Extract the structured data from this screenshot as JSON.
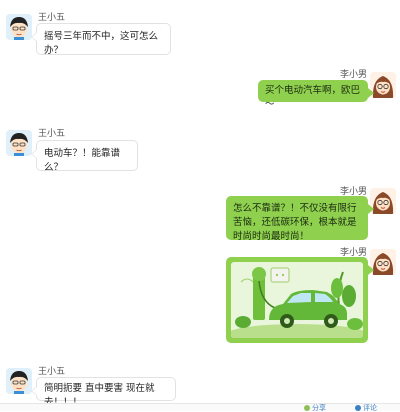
{
  "messages": [
    {
      "sender": "王小五",
      "side": "left",
      "text": "摇号三年而不中，这可怎么办？"
    },
    {
      "sender": "李小男",
      "side": "right",
      "text": "买个电动汽车啊，欧巴～"
    },
    {
      "sender": "王小五",
      "side": "left",
      "text": "电动车？！能靠谱么？"
    },
    {
      "sender": "李小男",
      "side": "right",
      "text": "怎么不靠谱？！不仅没有限行苦恼，还低碳环保，根本就是时尚时尚最时尚！"
    },
    {
      "sender": "李小男",
      "side": "right",
      "image": "green-electric-car-illustration"
    },
    {
      "sender": "王小五",
      "side": "left",
      "text": "简明扼要 直中要害 现在就去！！！"
    }
  ],
  "footer": {
    "link1": "分享",
    "link2": "评论"
  },
  "colors": {
    "right_bubble": "#8fd14f",
    "left_bubble_border": "#e2e2e2",
    "link": "#3b7fc4"
  },
  "avatars": {
    "male": "boy-avatar-icon",
    "female": "girl-avatar-icon"
  }
}
